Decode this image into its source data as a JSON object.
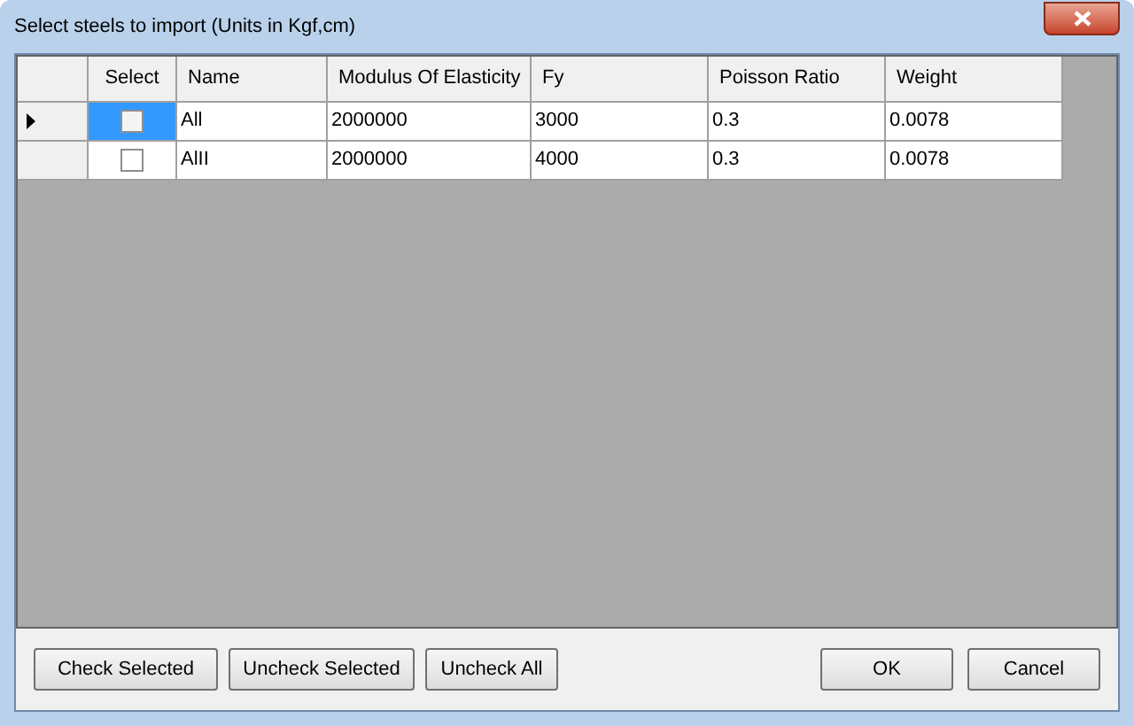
{
  "window": {
    "title": "Select steels to import (Units in Kgf,cm)"
  },
  "table": {
    "select_column": "Select",
    "columns": [
      "Name",
      "Modulus Of Elasticity",
      "Fy",
      "Poisson Ratio",
      "Weight"
    ],
    "rows": [
      {
        "selected": true,
        "checked": false,
        "cells": [
          "All",
          "2000000",
          "3000",
          "0.3",
          "0.0078"
        ]
      },
      {
        "selected": false,
        "checked": false,
        "cells": [
          "AlII",
          "2000000",
          "4000",
          "0.3",
          "0.0078"
        ]
      }
    ]
  },
  "buttons_left": [
    "Check Selected",
    "Uncheck Selected",
    "Uncheck All"
  ],
  "buttons_right": [
    "OK",
    "Cancel"
  ]
}
